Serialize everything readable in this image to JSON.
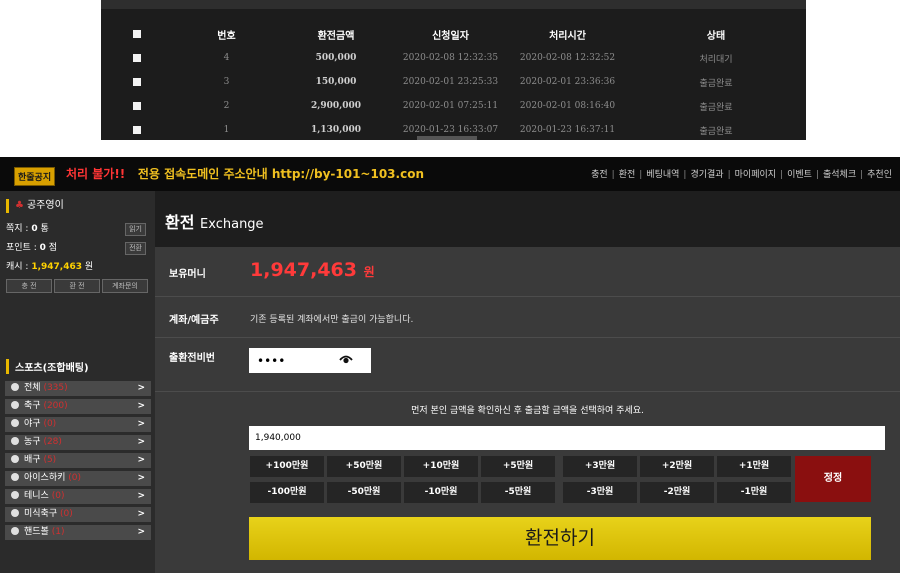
{
  "history": {
    "columns": [
      "번호",
      "환전금액",
      "신청일자",
      "처리시간",
      "상태"
    ],
    "rows": [
      {
        "no": "4",
        "amount": "500,000",
        "requested": "2020-02-08 12:32:35",
        "processed": "2020-02-08 12:32:52",
        "status": "처리대기"
      },
      {
        "no": "3",
        "amount": "150,000",
        "requested": "2020-02-01 23:25:33",
        "processed": "2020-02-01 23:36:36",
        "status": "출금완료"
      },
      {
        "no": "2",
        "amount": "2,900,000",
        "requested": "2020-02-01 07:25:11",
        "processed": "2020-02-01 08:16:40",
        "status": "출금완료"
      },
      {
        "no": "1",
        "amount": "1,130,000",
        "requested": "2020-01-23 16:33:07",
        "processed": "2020-01-23 16:37:11",
        "status": "출금완료"
      }
    ]
  },
  "ticker": {
    "badge": "한줄공지",
    "message_red": "처리 불가!!",
    "message_yellow": "전용 접속도메인 주소안내 http://by-101~103.con"
  },
  "topnav": [
    "충전",
    "환전",
    "베팅내역",
    "경기결과",
    "마이페이지",
    "이벤트",
    "출석체크",
    "추천인"
  ],
  "user": {
    "name": "공주영이",
    "note_label": "쪽지 : ",
    "note_count": "0",
    "note_unit": " 통",
    "read_btn": "읽기",
    "point_label": "포인트 : ",
    "point_value": "0",
    "point_unit": " 점",
    "convert_btn": "전환",
    "cash_label": "캐시 : ",
    "cash_value": "1,947,463",
    "cash_unit": " 원",
    "buttons": [
      "충 전",
      "환 전",
      "계좌문의"
    ]
  },
  "sports": {
    "title": "스포츠(조합배팅)",
    "items": [
      {
        "name": "전체",
        "count": "(335)"
      },
      {
        "name": "축구",
        "count": "(200)"
      },
      {
        "name": "야구",
        "count": "(0)"
      },
      {
        "name": "농구",
        "count": "(28)"
      },
      {
        "name": "배구",
        "count": "(5)"
      },
      {
        "name": "아이스하키",
        "count": "(0)"
      },
      {
        "name": "테니스",
        "count": "(0)"
      },
      {
        "name": "미식축구",
        "count": "(0)"
      },
      {
        "name": "핸드볼",
        "count": "(1)"
      }
    ]
  },
  "exchange": {
    "title": "환전",
    "title_en": "Exchange",
    "balance_label": "보유머니",
    "balance_value": "1,947,463",
    "balance_unit": "원",
    "account_label": "계좌/예금주",
    "account_note": "기존 등록된 계좌에서만 출금이 가능합니다.",
    "pw_label": "출환전비번",
    "pw_value": "••••",
    "guide": "먼저 본인 금액을 확인하신 후 출금할 금액을 선택하여 주세요.",
    "amount_value": "1,940,000",
    "plus_buttons": [
      "+100만원",
      "+50만원",
      "+10만원",
      "+5만원",
      "+3만원",
      "+2만원",
      "+1만원"
    ],
    "minus_buttons": [
      "-100만원",
      "-50만원",
      "-10만원",
      "-5만원",
      "-3만원",
      "-2만원",
      "-1만원"
    ],
    "reset_label": "정정",
    "submit_label": "환전하기"
  },
  "colors": {
    "accent": "#ff3a3a",
    "submit": "#e0c80f",
    "reset": "#8a0f0f"
  }
}
